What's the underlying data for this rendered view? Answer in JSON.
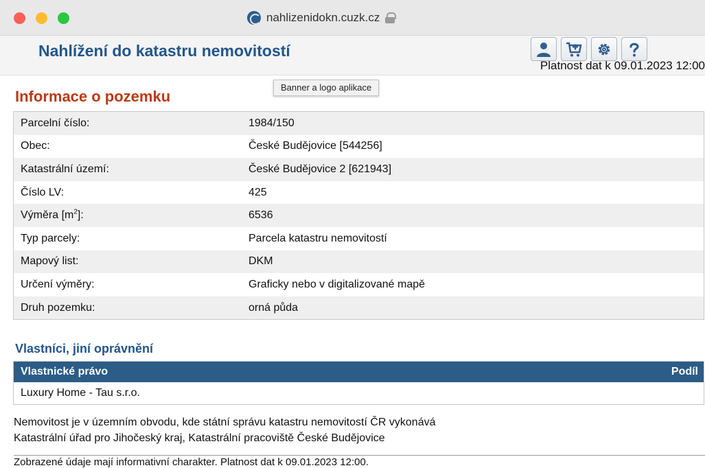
{
  "browser": {
    "url": "nahlizenidokn.cuzk.cz"
  },
  "header": {
    "title": "Nahlížení do katastru nemovitostí",
    "validity": "Platnost dat k 09.01.2023 12:00",
    "icons": [
      "user-icon",
      "cart-icon",
      "settings-icon",
      "help-icon"
    ]
  },
  "tooltip": "Banner a logo aplikace",
  "info": {
    "heading": "Informace o pozemku",
    "rows": [
      {
        "label": "Parcelní číslo:",
        "value": "1984/150"
      },
      {
        "label": "Obec:",
        "value": "České Budějovice [544256]"
      },
      {
        "label": "Katastrální území:",
        "value": "České Budějovice 2 [621943]"
      },
      {
        "label": "Číslo LV:",
        "value": "425"
      },
      {
        "label_pre": "Výměra [m",
        "label_sup": "2",
        "label_post": "]:",
        "value": "6536"
      },
      {
        "label": "Typ parcely:",
        "value": "Parcela katastru nemovitostí"
      },
      {
        "label": "Mapový list:",
        "value": "DKM"
      },
      {
        "label": "Určení výměry:",
        "value": "Graficky nebo v digitalizované mapě"
      },
      {
        "label": "Druh pozemku:",
        "value": "orná půda"
      }
    ]
  },
  "owners": {
    "heading": "Vlastníci, jiní oprávnění",
    "col_left": "Vlastnické právo",
    "col_right": "Podíl",
    "rows": [
      "Luxury Home - Tau s.r.o."
    ]
  },
  "note": {
    "line1": "Nemovitost je v územním obvodu, kde státní správu katastru nemovitostí ČR vykonává",
    "line2": "Katastrální úřad pro Jihočeský kraj, Katastrální pracoviště České Budějovice"
  },
  "footer": "Zobrazené údaje mají informativní charakter. Platnost dat k 09.01.2023 12:00.",
  "colors": {
    "title_blue": "#22568b",
    "heading_red": "#b93a16",
    "table_header": "#2b5d87"
  }
}
